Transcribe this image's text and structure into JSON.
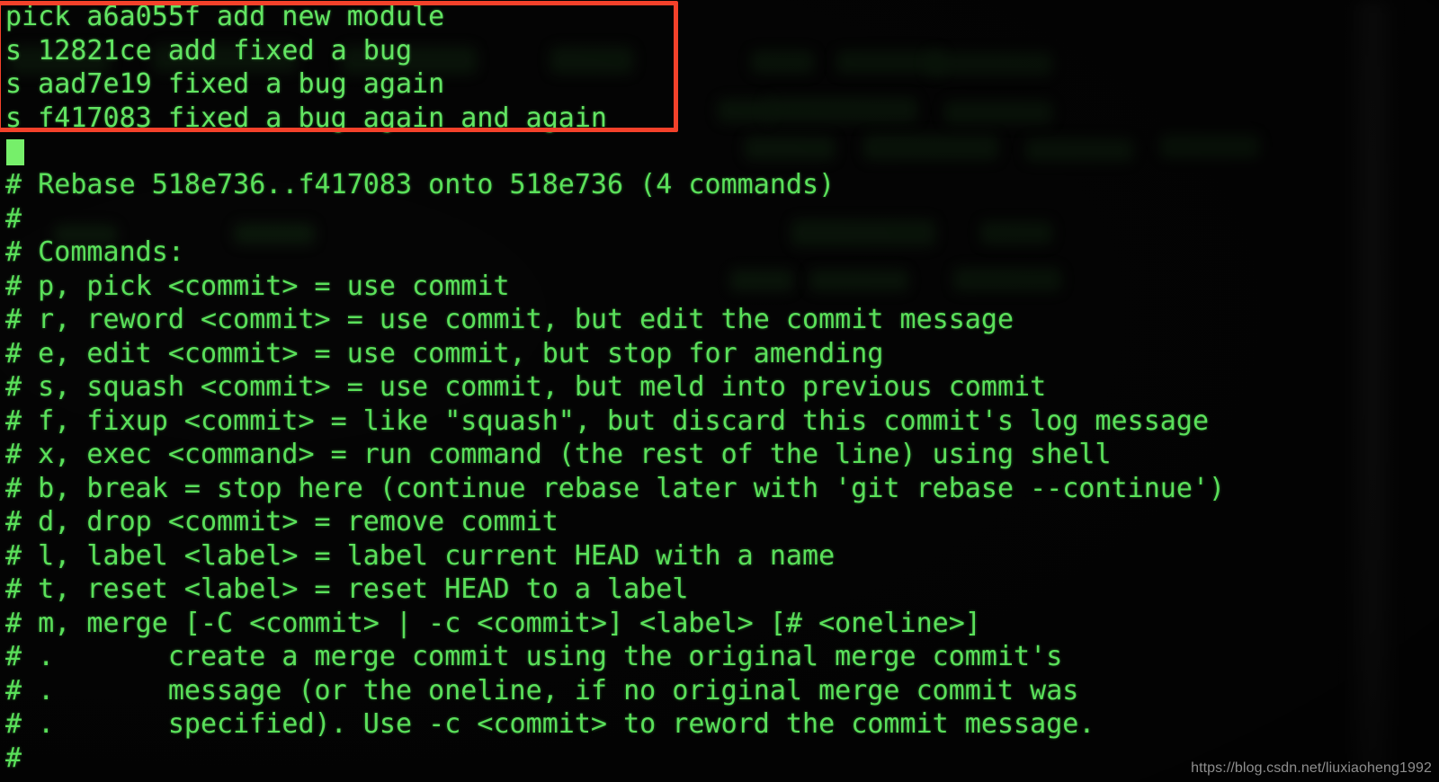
{
  "app": {
    "kind": "terminal-text-editor",
    "context": "git interactive rebase todo list"
  },
  "colors": {
    "background": "#050505",
    "text_green": "#5fe35f",
    "cursor_green": "#76ef6a",
    "annotation_red": "#f4412a",
    "watermark_gray": "#9a9a9a"
  },
  "todo_lines": [
    {
      "action": "pick",
      "hash": "a6a055f",
      "subject": "add new module",
      "text": "pick a6a055f add new module"
    },
    {
      "action": "s",
      "hash": "12821ce",
      "subject": "add fixed a bug",
      "text": "s 12821ce add fixed a bug"
    },
    {
      "action": "s",
      "hash": "aad7e19",
      "subject": "fixed a bug again",
      "text": "s aad7e19 fixed a bug again"
    },
    {
      "action": "s",
      "hash": "f417083",
      "subject": "fixed a bug again and again",
      "text": "s f417083 fixed a bug again and again"
    }
  ],
  "cursor": {
    "visible": true,
    "symbol": "█"
  },
  "comment_lines": [
    "# Rebase 518e736..f417083 onto 518e736 (4 commands)",
    "#",
    "# Commands:",
    "# p, pick <commit> = use commit",
    "# r, reword <commit> = use commit, but edit the commit message",
    "# e, edit <commit> = use commit, but stop for amending",
    "# s, squash <commit> = use commit, but meld into previous commit",
    "# f, fixup <commit> = like \"squash\", but discard this commit's log message",
    "# x, exec <command> = run command (the rest of the line) using shell",
    "# b, break = stop here (continue rebase later with 'git rebase --continue')",
    "# d, drop <commit> = remove commit",
    "# l, label <label> = label current HEAD with a name",
    "# t, reset <label> = reset HEAD to a label",
    "# m, merge [-C <commit> | -c <commit>] <label> [# <oneline>]",
    "# .       create a merge commit using the original merge commit's",
    "# .       message (or the oneline, if no original merge commit was",
    "# .       specified). Use -c <commit> to reword the commit message.",
    "#"
  ],
  "rebase_header": {
    "range_from": "518e736",
    "range_to": "f417083",
    "onto": "518e736",
    "command_count": "4 commands"
  },
  "annotation": {
    "type": "red-rectangle",
    "covers": "the four todo command lines"
  },
  "watermark": {
    "text": "https://blog.csdn.net/liuxiaoheng1992"
  }
}
